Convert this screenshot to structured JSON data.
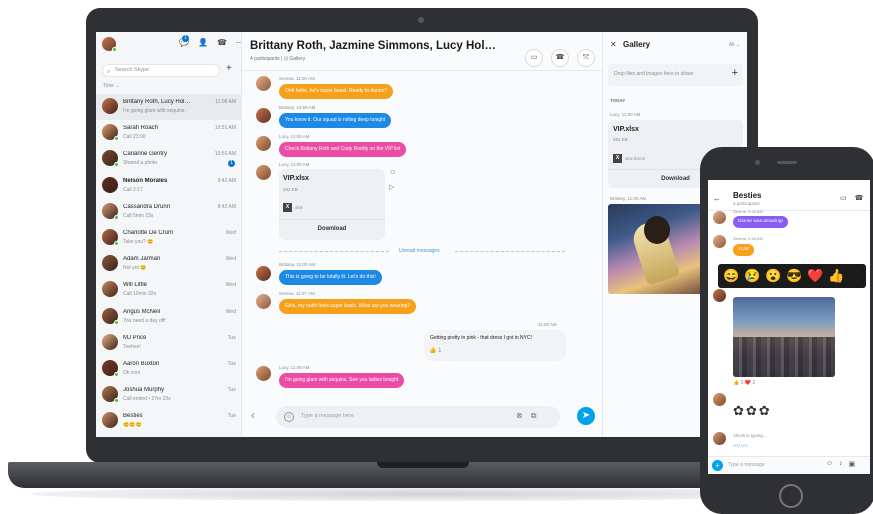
{
  "sidebar": {
    "search_placeholder": "Search Skype",
    "sort_label": "Time ⌄",
    "notification_count": "1",
    "contacts": [
      {
        "name": "Brittany Roth, Lucy Hol…",
        "sub": "I'm going glam with sequins.",
        "time": "11:08 AM",
        "active": true
      },
      {
        "name": "Sarah Roach",
        "sub": "Call 23:00",
        "time": "10:51 AM"
      },
      {
        "name": "Carianne Gentry",
        "sub": "Shared a photo",
        "time": "10:50 AM",
        "unread": "1"
      },
      {
        "name": "Nelson Morales",
        "sub": "Call 2:17",
        "time": "9:42 AM",
        "bold": true
      },
      {
        "name": "Cassandra Drunn",
        "sub": "Call 5min 23s",
        "time": "8:42 AM"
      },
      {
        "name": "Charlotte De Crum",
        "sub": "Take you? 😊",
        "time": "Wed"
      },
      {
        "name": "Adam Jarman",
        "sub": "Not yet 😊",
        "time": "Wed"
      },
      {
        "name": "Will Little",
        "sub": "Call 10min 32s",
        "time": "Wed"
      },
      {
        "name": "Angus McNeil",
        "sub": "You need a day off!",
        "time": "Wed"
      },
      {
        "name": "MJ Price",
        "sub": "Teehee!",
        "time": "Tue"
      },
      {
        "name": "Aaron Buxton",
        "sub": "Ok cool",
        "time": "Tue"
      },
      {
        "name": "Joshua Murphy",
        "sub": "Call ended • 27m 23s",
        "time": "Tue"
      },
      {
        "name": "Besties",
        "sub": "😊😊😊",
        "time": "Tue"
      }
    ]
  },
  "chat": {
    "title": "Brittany Roth, Jazmine Simmons, Lucy Hol…",
    "subtitle": "4 participants  |  ⊡ Gallery",
    "messages": [
      {
        "meta": "Serena, 11:00 AM",
        "text": "Ooh hehe, he's super boast. Ready to dance?",
        "color": "#f7a01c"
      },
      {
        "meta": "Brittany, 10:59 AM",
        "text": "You know it. Our squad is rolling deep tonight",
        "color": "#1e88e5"
      },
      {
        "meta": "Lucy, 11:00 AM",
        "text": "Check Brittany Roth and Cody Roddy on the VIP list",
        "color": "#ec4ba6"
      },
      {
        "meta": "Lucy, 11:00 AM",
        "text": ""
      },
      {
        "meta": "Brittany, 11:00 AM",
        "text": "This is going to be totally lit. Let's do this!",
        "color": "#1e88e5"
      },
      {
        "meta": "Serena, 11:07 AM",
        "text": "Girls, my outfit feels super basic. What are you wearing?",
        "color": "#f7a01c"
      },
      {
        "meta": "Lucy, 11:08 AM",
        "text": "I'm going glam with sequins. See you ladies tonight",
        "color": "#ec4ba6"
      }
    ],
    "file": {
      "name": "VIP.xlsx",
      "size": "282 KB",
      "type": "xlsx",
      "download": "Download"
    },
    "unread_label": "Unread messages",
    "reply": {
      "time": "11:08 AM",
      "text": "Getting pretty in pink - that dress I got in NYC!",
      "reaction": "👍 1"
    },
    "compose_placeholder": "Type a message here"
  },
  "gallery": {
    "title": "Gallery",
    "filter": "All ⌄",
    "drop_text": "Drop files and images here to share",
    "today_label": "TODAY",
    "file_meta": "Lucy, 11:00 AM",
    "file_name": "VIP.xlsx",
    "file_size": "282 KB",
    "file_type": "xlsx Excel",
    "download": "Download",
    "photo_meta": "Brittany, 11:00 AM"
  },
  "phone": {
    "title": "Besties",
    "subtitle": "3 participants",
    "messages": [
      {
        "meta": "Serena, 9:45 AM",
        "text": "Dinner was amazing!",
        "color": "#8a5cf6"
      },
      {
        "meta": "Serena, 9:46 AM",
        "text": "YUM",
        "color": "#f7a01c"
      }
    ],
    "reactions": [
      "😄",
      "😢",
      "😮",
      "😎",
      "❤️",
      "👍"
    ],
    "photo_reactions": "👍 3   ❤️ 2",
    "typing_text": "Alexis is typing…",
    "compose_placeholder": "Type a message"
  }
}
